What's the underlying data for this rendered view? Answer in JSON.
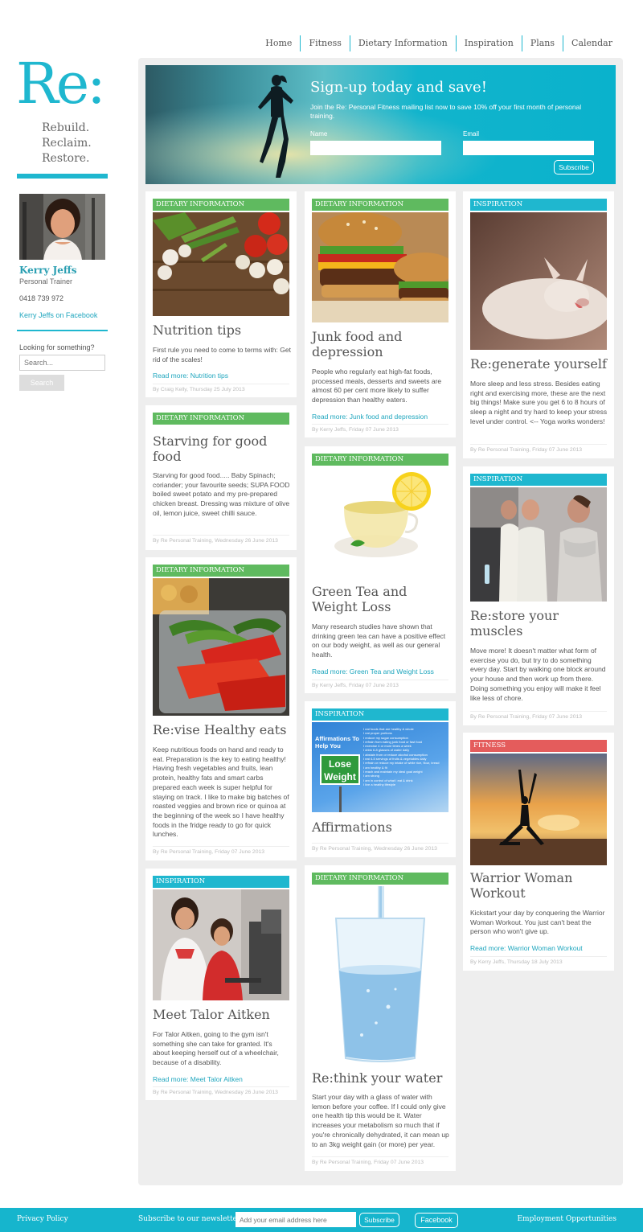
{
  "nav": [
    "Home",
    "Fitness",
    "Dietary Information",
    "Inspiration",
    "Plans",
    "Calendar"
  ],
  "sidebar": {
    "logo": "Re:",
    "tagline": [
      "Rebuild.",
      "Reclaim.",
      "Restore."
    ],
    "trainer_name": "Kerry Jeffs",
    "trainer_role": "Personal Trainer",
    "phone": "0418 739 972",
    "facebook_link": "Kerry Jeffs on Facebook",
    "search_label": "Looking for something?",
    "search_placeholder": "Search...",
    "search_button": "Search"
  },
  "hero": {
    "title": "Sign-up today and save!",
    "text": "Join the Re: Personal Fitness mailing list now to save 10% off your first month of personal training.",
    "name_label": "Name",
    "email_label": "Email",
    "subscribe": "Subscribe"
  },
  "articles": [
    {
      "category": "DIETARY INFORMATION",
      "title": "Nutrition tips",
      "excerpt": "First rule you need to come to terms with: Get rid of the scales!",
      "more": "Read more: Nutrition tips",
      "byline": "By Craig Kelly, Thursday 25 July 2013"
    },
    {
      "category": "DIETARY INFORMATION",
      "title": "Starving for good food",
      "excerpt": "Starving for good food..... Baby Spinach; coriander; your favourite seeds; SUPA FOOD boiled sweet potato and my pre-prepared chicken breast. Dressing was mixture of olive oil, lemon juice, sweet chilli sauce.",
      "more": "",
      "byline": "By Re Personal Training, Wednesday 26 June 2013"
    },
    {
      "category": "DIETARY INFORMATION",
      "title": "Re:vise Healthy eats",
      "excerpt": "Keep nutritious foods on hand and ready to eat. Preparation is the key to eating healthy! Having fresh vegetables and fruits, lean protein, healthy fats and smart carbs prepared each week is super helpful for staying on track. I like to make big batches of roasted veggies and brown rice or quinoa at the beginning of the week so I have healthy foods in the fridge ready to go for quick lunches.",
      "more": "",
      "byline": "By Re Personal Training, Friday 07 June 2013"
    },
    {
      "category": "INSPIRATION",
      "title": "Meet Talor Aitken",
      "excerpt": "For Talor Aitken, going to the gym isn't something she can take for granted. It's about keeping herself out of a wheelchair, because of a disability.",
      "more": "Read more: Meet Talor Aitken",
      "byline": "By Re Personal Training, Wednesday 26 June 2013"
    },
    {
      "category": "DIETARY INFORMATION",
      "title": "Junk food and depression",
      "excerpt": "People who regularly eat high-fat foods, processed meals, desserts and sweets are almost 60 per cent more likely to suffer depression than healthy eaters.",
      "more": "Read more: Junk food and depression",
      "byline": "By Kerry Jeffs, Friday 07 June 2013"
    },
    {
      "category": "DIETARY INFORMATION",
      "title": "Green Tea and Weight Loss",
      "excerpt": "Many research studies have shown that drinking green tea can have a positive effect on our body weight, as well as our general health.",
      "more": "Read more: Green Tea and Weight Loss",
      "byline": "By Kerry Jeffs, Friday 07 June 2013"
    },
    {
      "category": "INSPIRATION",
      "title": "Affirmations",
      "excerpt": "",
      "more": "",
      "byline": "By Re Personal Training, Wednesday 26 June 2013"
    },
    {
      "category": "DIETARY INFORMATION",
      "title": "Re:think your water",
      "excerpt": "Start your day with a glass of water with lemon before your coffee. If I could only give one health tip this would be it. Water increases your metabolism so much that if you're chronically dehydrated, it can mean up to an 3kg weight gain (or more) per year.",
      "more": "",
      "byline": "By Re Personal Training, Friday 07 June 2013"
    },
    {
      "category": "INSPIRATION",
      "title": "Re:generate yourself",
      "excerpt": "More sleep and less stress. Besides eating right and exercising more, these are the next big things! Make sure you get 6 to 8 hours of sleep a night and try hard to keep your stress level under control. <-- Yoga works wonders!",
      "more": "",
      "byline": "By Re Personal Training, Friday 07 June 2013"
    },
    {
      "category": "INSPIRATION",
      "title": "Re:store your muscles",
      "excerpt": "Move more! It doesn't matter what form of exercise you do, but try to do something every day. Start by walking one block around your house and then work up from there. Doing something you enjoy will make it feel like less of chore.",
      "more": "",
      "byline": "By Re Personal Training, Friday 07 June 2013"
    },
    {
      "category": "FITNESS",
      "title": "Warrior Woman Workout",
      "excerpt": "Kickstart your day by conquering the Warrior Woman Workout. You just can't beat the person who won't give up.",
      "more": "Read more: Warrior Woman Workout",
      "byline": "By Kerry Jeffs, Thursday 18 July 2013"
    }
  ],
  "affirmations_image": {
    "heading": "Affirmations To Help You",
    "sign": [
      "Lose",
      "Weight"
    ],
    "list": [
      "I eat foods that are healthy & whole",
      "I eat proper portions",
      "I reduce my sugar consumption",
      "I refrain from eating junk food or fast food",
      "I exercise 4 or more times a week",
      "I drink 6-8 glasses of water daily",
      "I abstain from or reduce alcohol consumption",
      "I eat 4-5 servings of fruits & vegetables daily",
      "I refrain or reduce my intake of white rice, flour, bread",
      "I am healthy & fit",
      "I reach and maintain my ideal goal weight",
      "I am strong",
      "I am in control of what I eat & drink",
      "I live a healthy lifestyle"
    ]
  },
  "footer": {
    "privacy": "Privacy Policy",
    "subscribe_label": "Subscribe to our newsletter:",
    "email_placeholder": "Add your email address here",
    "subscribe_button": "Subscribe",
    "facebook": "Facebook",
    "jobs": "Employment Opportunities"
  },
  "colors": {
    "accent": "#1fb7cf",
    "dietary": "#5fba5f",
    "inspiration": "#1fb7cf",
    "fitness": "#e45c5c"
  }
}
